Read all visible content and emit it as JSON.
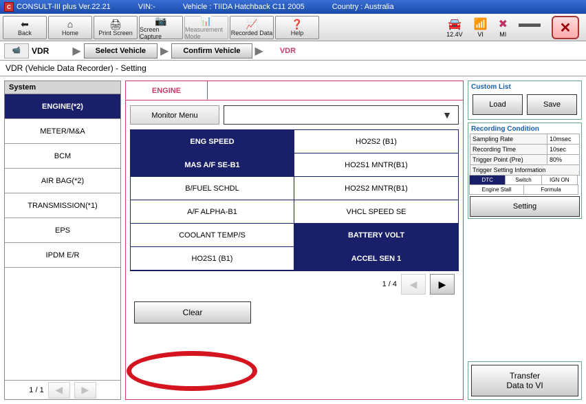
{
  "titlebar": {
    "app": "CONSULT-III plus  Ver.22.21",
    "vin": "VIN:-",
    "vehicle": "Vehicle : TIIDA Hatchback C11 2005",
    "country": "Country : Australia"
  },
  "toolbar": {
    "back": "Back",
    "home": "Home",
    "print": "Print Screen",
    "capture": "Screen Capture",
    "measure": "Measurement Mode",
    "recorded": "Recorded Data",
    "help": "Help"
  },
  "status": {
    "voltage": "12.4V",
    "vi": "VI",
    "mi": "MI"
  },
  "breadcrumb": {
    "root": "VDR",
    "select": "Select Vehicle",
    "confirm": "Confirm Vehicle",
    "current": "VDR"
  },
  "subtitle": "VDR (Vehicle Data Recorder) - Setting",
  "system": {
    "header": "System",
    "items": [
      "ENGINE(*2)",
      "METER/M&A",
      "BCM",
      "AIR BAG(*2)",
      "TRANSMISSION(*1)",
      "EPS",
      "IPDM E/R"
    ],
    "page": "1 / 1"
  },
  "tab": "ENGINE",
  "monitorMenu": "Monitor Menu",
  "cells": [
    "ENG SPEED",
    "HO2S2 (B1)",
    "MAS A/F SE-B1",
    "HO2S1 MNTR(B1)",
    "B/FUEL SCHDL",
    "HO2S2 MNTR(B1)",
    "A/F ALPHA-B1",
    "VHCL SPEED SE",
    "COOLANT TEMP/S",
    "BATTERY VOLT",
    "HO2S1 (B1)",
    "ACCEL SEN 1"
  ],
  "cellSelected": [
    true,
    false,
    true,
    false,
    false,
    false,
    false,
    false,
    false,
    true,
    false,
    true
  ],
  "gridPage": "1 / 4",
  "clear": "Clear",
  "customList": {
    "header": "Custom List",
    "load": "Load",
    "save": "Save"
  },
  "rec": {
    "header": "Recording Condition",
    "rows": [
      {
        "k": "Sampling Rate",
        "v": "10msec"
      },
      {
        "k": "Recording Time",
        "v": "10sec"
      },
      {
        "k": "Trigger Point (Pre)",
        "v": "80%"
      },
      {
        "k": "Trigger Setting Information",
        "v": ""
      }
    ],
    "ts": [
      "DTC",
      "Switch",
      "IGN ON",
      "Engine Stall",
      "Formula"
    ],
    "tsSel": [
      true,
      false,
      false,
      false,
      false
    ],
    "setting": "Setting"
  },
  "transfer": "Transfer\nData to VI"
}
